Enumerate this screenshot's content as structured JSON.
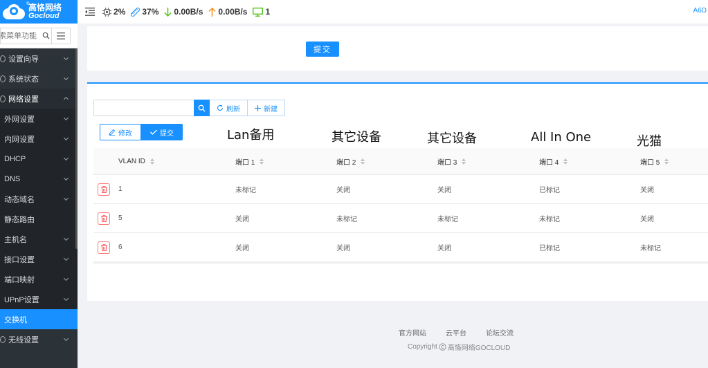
{
  "brand": {
    "name_cn": "高恪网络",
    "name_en": "Gocloud",
    "reg": "®"
  },
  "sidebar": {
    "search_placeholder": "搜索菜单功能",
    "items": [
      {
        "label": "设置向导",
        "type": "top"
      },
      {
        "label": "系统状态",
        "type": "top"
      },
      {
        "label": "网络设置",
        "type": "parent"
      },
      {
        "label": "外网设置",
        "type": "sub"
      },
      {
        "label": "内网设置",
        "type": "sub"
      },
      {
        "label": "DHCP",
        "type": "sub"
      },
      {
        "label": "DNS",
        "type": "sub"
      },
      {
        "label": "动态域名",
        "type": "sub"
      },
      {
        "label": "静态路由",
        "type": "sub-nochev"
      },
      {
        "label": "主机名",
        "type": "sub"
      },
      {
        "label": "接口设置",
        "type": "sub"
      },
      {
        "label": "端口映射",
        "type": "sub"
      },
      {
        "label": "UPnP设置",
        "type": "sub"
      },
      {
        "label": "交换机",
        "type": "active"
      },
      {
        "label": "无线设置",
        "type": "top"
      }
    ]
  },
  "topbar": {
    "cpu": "2%",
    "mem": "37%",
    "down": "0.00B/s",
    "up": "0.00B/s",
    "devices": "1",
    "right_text": "A6D"
  },
  "panel1": {
    "submit_label": "提交"
  },
  "toolbar": {
    "refresh_label": "刷新",
    "new_label": "新建",
    "edit_label": "修改",
    "submit_label": "提交"
  },
  "annotations": [
    "Lan备用",
    "其它设备",
    "其它设备",
    "All In One",
    "光猫"
  ],
  "table": {
    "columns": [
      "VLAN ID",
      "端口 1",
      "端口 2",
      "端口 3",
      "端口 4",
      "端口 5"
    ],
    "rows": [
      [
        "1",
        "未标记",
        "关闭",
        "关闭",
        "已标记",
        "关闭"
      ],
      [
        "5",
        "关闭",
        "未标记",
        "未标记",
        "未标记",
        "关闭"
      ],
      [
        "6",
        "关闭",
        "关闭",
        "关闭",
        "已标记",
        "未标记"
      ]
    ]
  },
  "footer": {
    "links": [
      "官方网站",
      "云平台",
      "论坛交流"
    ],
    "copyright_prefix": "Copyright",
    "copyright_owner": "高恪网络GOCLOUD"
  },
  "colors": {
    "accent": "#1890ff",
    "sidebar_bg": "#2b3238",
    "danger": "#ff4d4f"
  }
}
